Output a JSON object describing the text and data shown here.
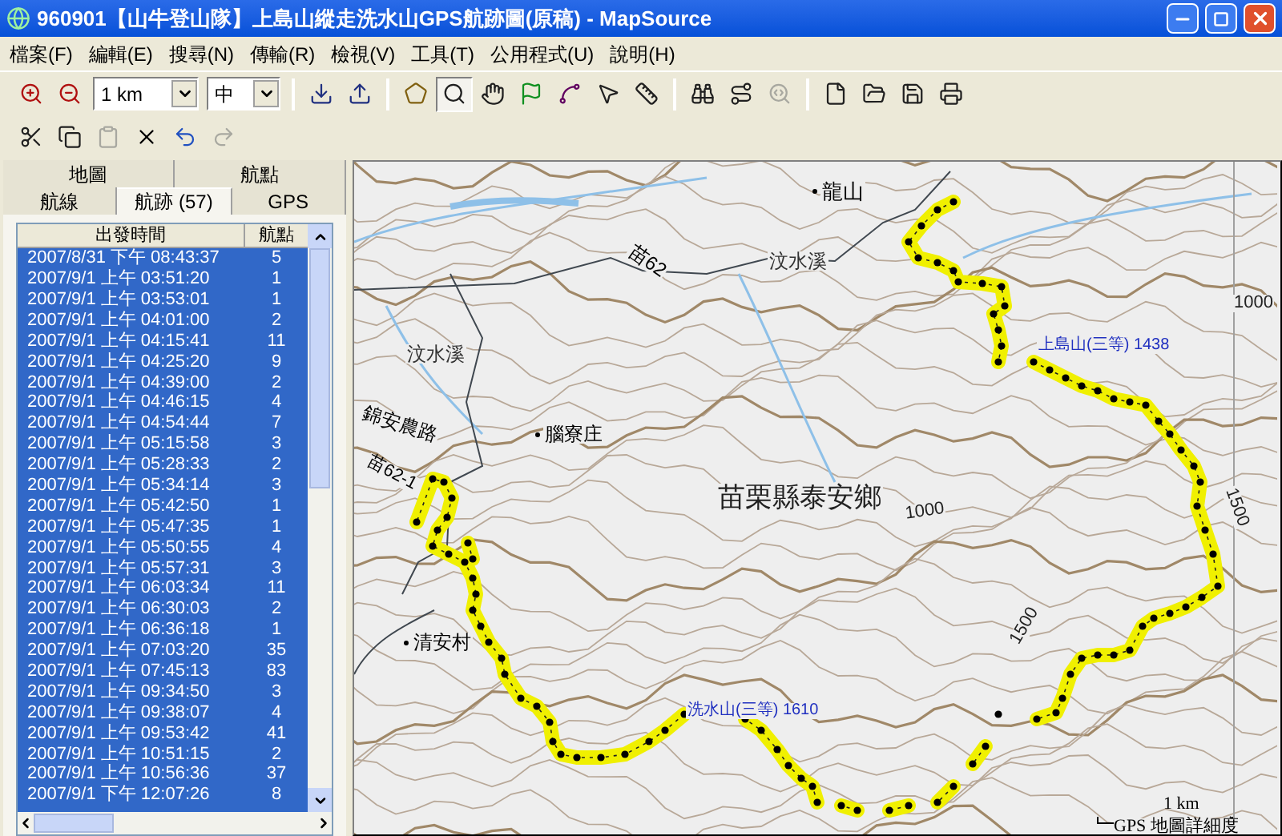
{
  "window": {
    "title": "960901【山牛登山隊】上島山縱走洗水山GPS航跡圖(原稿) - MapSource"
  },
  "menu": [
    "檔案(F)",
    "編輯(E)",
    "搜尋(N)",
    "傳輸(R)",
    "檢視(V)",
    "工具(T)",
    "公用程式(U)",
    "說明(H)"
  ],
  "toolbar": {
    "scale_select": "1 km",
    "detail_select": "中",
    "groups": [
      [
        {
          "kind": "zoom-in",
          "pressed": false,
          "disabled": false
        },
        {
          "kind": "zoom-out",
          "pressed": false,
          "disabled": false
        }
      ],
      [
        {
          "kind": "receive",
          "pressed": false,
          "disabled": false
        },
        {
          "kind": "send",
          "pressed": false,
          "disabled": false
        }
      ],
      [
        {
          "kind": "area",
          "pressed": false,
          "disabled": false
        },
        {
          "kind": "zoom-tool",
          "pressed": true,
          "disabled": false
        },
        {
          "kind": "hand",
          "pressed": false,
          "disabled": false
        },
        {
          "kind": "flag",
          "pressed": false,
          "disabled": false
        },
        {
          "kind": "route",
          "pressed": false,
          "disabled": false
        },
        {
          "kind": "pointer",
          "pressed": false,
          "disabled": false
        },
        {
          "kind": "ruler",
          "pressed": false,
          "disabled": false
        }
      ],
      [
        {
          "kind": "find",
          "pressed": false,
          "disabled": false
        },
        {
          "kind": "find-route",
          "pressed": false,
          "disabled": false
        },
        {
          "kind": "find-next",
          "pressed": false,
          "disabled": true
        }
      ],
      [
        {
          "kind": "new",
          "pressed": false,
          "disabled": false
        },
        {
          "kind": "open",
          "pressed": false,
          "disabled": false
        },
        {
          "kind": "save",
          "pressed": false,
          "disabled": false
        },
        {
          "kind": "print",
          "pressed": false,
          "disabled": false
        }
      ]
    ],
    "edit_tools": [
      {
        "kind": "cut",
        "disabled": false
      },
      {
        "kind": "copy",
        "disabled": false
      },
      {
        "kind": "paste",
        "disabled": true
      },
      {
        "kind": "delete",
        "disabled": false
      },
      {
        "kind": "undo",
        "disabled": false
      },
      {
        "kind": "redo",
        "disabled": true
      }
    ]
  },
  "tabs": [
    {
      "label": "地圖",
      "selected": false
    },
    {
      "label": "航點",
      "selected": false
    },
    {
      "label": "航線",
      "selected": false
    },
    {
      "label": "航跡 (57)",
      "selected": true
    },
    {
      "label": "GPS",
      "selected": false
    }
  ],
  "track_list": {
    "columns": [
      "出發時間",
      "航點"
    ],
    "rows": [
      {
        "time": "2007/8/31 下午 08:43:37",
        "points": "5",
        "selected": true
      },
      {
        "time": "2007/9/1 上午 03:51:20",
        "points": "1",
        "selected": true
      },
      {
        "time": "2007/9/1 上午 03:53:01",
        "points": "1",
        "selected": true
      },
      {
        "time": "2007/9/1 上午 04:01:00",
        "points": "2",
        "selected": true
      },
      {
        "time": "2007/9/1 上午 04:15:41",
        "points": "11",
        "selected": true
      },
      {
        "time": "2007/9/1 上午 04:25:20",
        "points": "9",
        "selected": true
      },
      {
        "time": "2007/9/1 上午 04:39:00",
        "points": "2",
        "selected": true
      },
      {
        "time": "2007/9/1 上午 04:46:15",
        "points": "4",
        "selected": true
      },
      {
        "time": "2007/9/1 上午 04:54:44",
        "points": "7",
        "selected": true
      },
      {
        "time": "2007/9/1 上午 05:15:58",
        "points": "3",
        "selected": true
      },
      {
        "time": "2007/9/1 上午 05:28:33",
        "points": "2",
        "selected": true
      },
      {
        "time": "2007/9/1 上午 05:34:14",
        "points": "3",
        "selected": true
      },
      {
        "time": "2007/9/1 上午 05:42:50",
        "points": "1",
        "selected": true
      },
      {
        "time": "2007/9/1 上午 05:47:35",
        "points": "1",
        "selected": true
      },
      {
        "time": "2007/9/1 上午 05:50:55",
        "points": "4",
        "selected": true
      },
      {
        "time": "2007/9/1 上午 05:57:31",
        "points": "3",
        "selected": true
      },
      {
        "time": "2007/9/1 上午 06:03:34",
        "points": "11",
        "selected": true
      },
      {
        "time": "2007/9/1 上午 06:30:03",
        "points": "2",
        "selected": true
      },
      {
        "time": "2007/9/1 上午 06:36:18",
        "points": "1",
        "selected": true
      },
      {
        "time": "2007/9/1 上午 07:03:20",
        "points": "35",
        "selected": true
      },
      {
        "time": "2007/9/1 上午 07:45:13",
        "points": "83",
        "selected": true
      },
      {
        "time": "2007/9/1 上午 09:34:50",
        "points": "3",
        "selected": true
      },
      {
        "time": "2007/9/1 上午 09:38:07",
        "points": "4",
        "selected": true
      },
      {
        "time": "2007/9/1 上午 09:53:42",
        "points": "41",
        "selected": true
      },
      {
        "time": "2007/9/1 上午 10:51:15",
        "points": "2",
        "selected": true
      },
      {
        "time": "2007/9/1 上午 10:56:36",
        "points": "37",
        "selected": true
      },
      {
        "time": "2007/9/1 下午 12:07:26",
        "points": "8",
        "selected": true
      }
    ]
  },
  "map": {
    "labels": [
      {
        "kind": "place",
        "text": "龍山"
      },
      {
        "kind": "road",
        "text": "苗62"
      },
      {
        "kind": "stream",
        "text": "汶水溪"
      },
      {
        "kind": "stream",
        "text": "汶水溪"
      },
      {
        "kind": "road",
        "text": "錦安農路"
      },
      {
        "kind": "road",
        "text": "苗62-1"
      },
      {
        "kind": "place",
        "text": "腦寮庄"
      },
      {
        "kind": "region",
        "text": "苗栗縣泰安鄉"
      },
      {
        "kind": "contour",
        "text": "1000"
      },
      {
        "kind": "contour",
        "text": "1000"
      },
      {
        "kind": "peak",
        "text": "上島山(三等) 1438"
      },
      {
        "kind": "contour",
        "text": "1500"
      },
      {
        "kind": "contour",
        "text": "1500"
      },
      {
        "kind": "place",
        "text": "清安村"
      },
      {
        "kind": "peak",
        "text": "洗水山(三等) 1610"
      }
    ],
    "scale": "1 km",
    "detail_note": "GPS 地圖詳細度"
  }
}
